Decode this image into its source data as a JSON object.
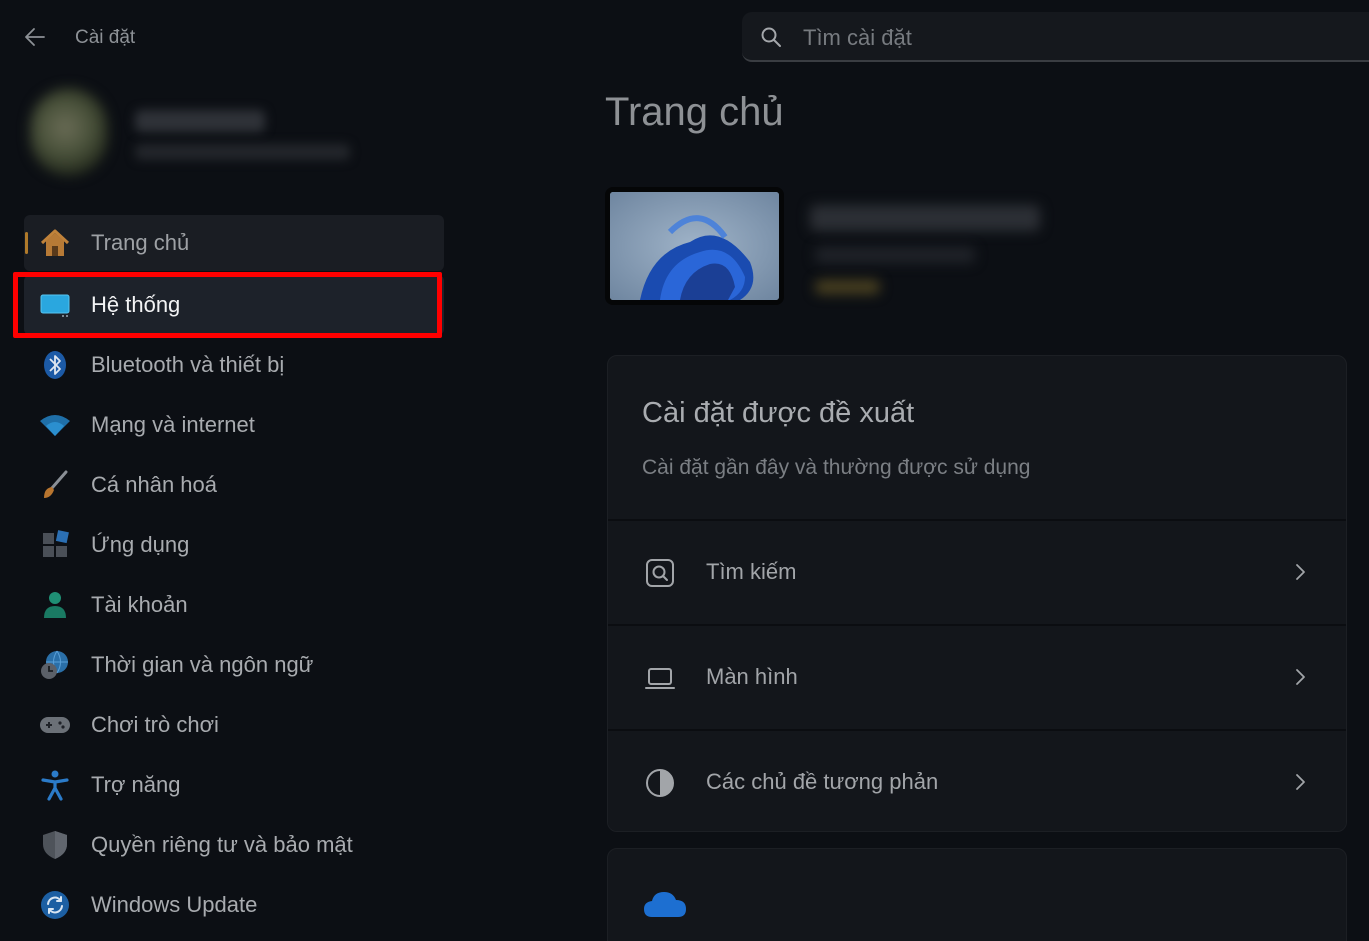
{
  "window": {
    "title": "Cài đặt"
  },
  "search": {
    "placeholder": "Tìm cài đặt"
  },
  "sidebar": {
    "items": [
      {
        "label": "Trang chủ",
        "icon": "home-icon"
      },
      {
        "label": "Hệ thống",
        "icon": "monitor-icon"
      },
      {
        "label": "Bluetooth và thiết bị",
        "icon": "bluetooth-icon"
      },
      {
        "label": "Mạng và internet",
        "icon": "wifi-icon"
      },
      {
        "label": "Cá nhân hoá",
        "icon": "brush-icon"
      },
      {
        "label": "Ứng dụng",
        "icon": "apps-icon"
      },
      {
        "label": "Tài khoản",
        "icon": "person-icon"
      },
      {
        "label": "Thời gian và ngôn ngữ",
        "icon": "globe-clock-icon"
      },
      {
        "label": "Chơi trò chơi",
        "icon": "gamepad-icon"
      },
      {
        "label": "Trợ năng",
        "icon": "accessibility-icon"
      },
      {
        "label": "Quyền riêng tư và bảo mật",
        "icon": "shield-icon"
      },
      {
        "label": "Windows Update",
        "icon": "update-icon"
      }
    ]
  },
  "main": {
    "title": "Trang chủ",
    "recommended": {
      "title": "Cài đặt được đề xuất",
      "subtitle": "Cài đặt gần đây và thường được sử dụng",
      "rows": [
        {
          "label": "Tìm kiếm",
          "icon": "search-settings-icon"
        },
        {
          "label": "Màn hình",
          "icon": "laptop-icon"
        },
        {
          "label": "Các chủ đề tương phản",
          "icon": "contrast-icon"
        }
      ]
    }
  },
  "colors": {
    "background": "#0c0f14",
    "highlight": "#ff0000",
    "accent": "#b07a2a",
    "cloud": "#1d6fd1"
  }
}
